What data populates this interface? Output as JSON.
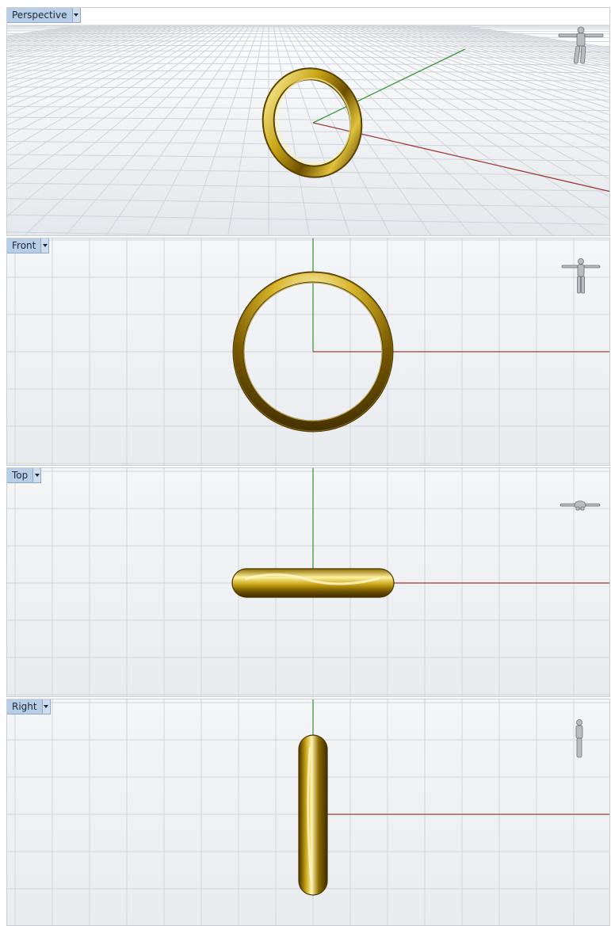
{
  "viewports": [
    {
      "id": "perspective",
      "label": "Perspective"
    },
    {
      "id": "front",
      "label": "Front"
    },
    {
      "id": "top",
      "label": "Top"
    },
    {
      "id": "right",
      "label": "Right"
    }
  ],
  "icons": {
    "viewport_menu": "chevron-down-icon",
    "scale_figure": "human-figure-icon"
  },
  "colors": {
    "x_axis": "#a03a3a",
    "y_axis": "#3c9a3c",
    "grid": "#d4d8dc",
    "gold_light": "#fff6a8",
    "gold_mid": "#c9a516",
    "gold_dark": "#5c4300",
    "tab_bg": "#b8cde6"
  }
}
